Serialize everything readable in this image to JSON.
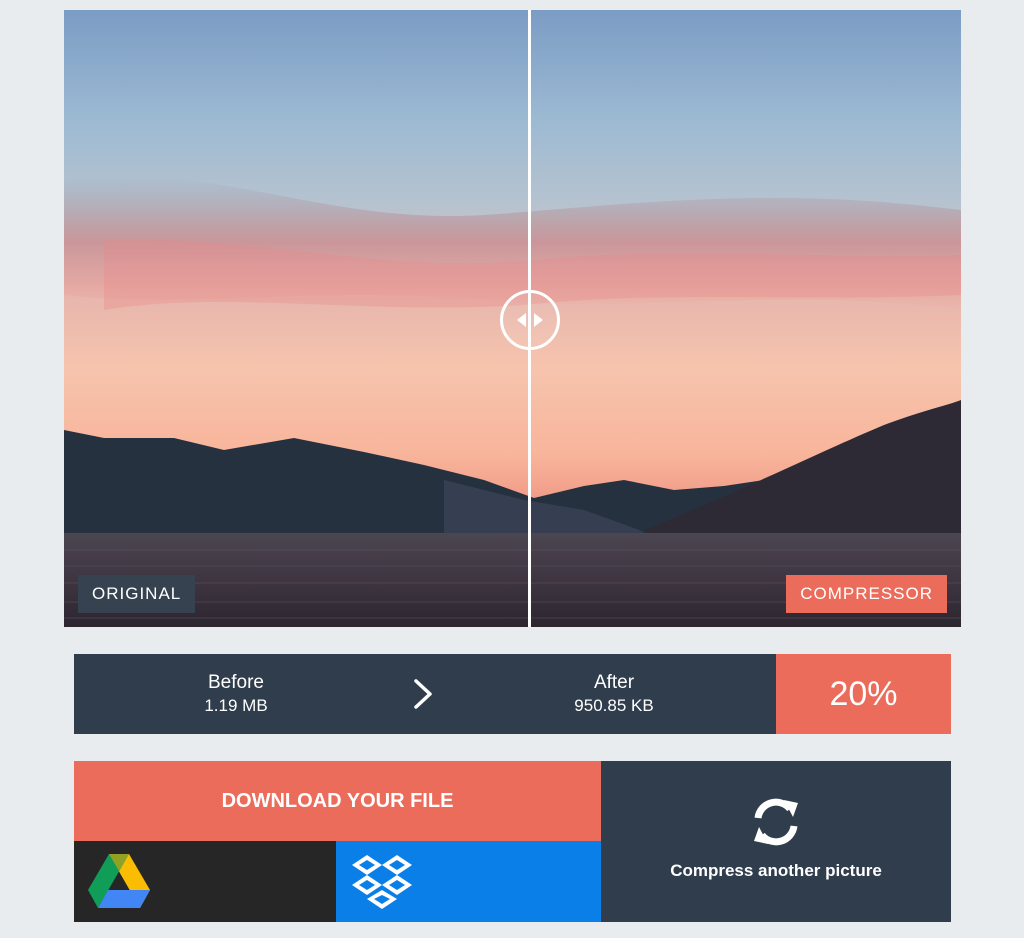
{
  "viewer": {
    "left_label": "ORIGINAL",
    "right_label": "COMPRESSOR"
  },
  "stats": {
    "before_label": "Before",
    "before_value": "1.19 MB",
    "after_label": "After",
    "after_value": "950.85 KB",
    "percent": "20%"
  },
  "actions": {
    "download_label": "DOWNLOAD YOUR FILE",
    "compress_again_label": "Compress another picture",
    "gdrive_icon": "google-drive-icon",
    "dropbox_icon": "dropbox-icon",
    "refresh_icon": "refresh-icon"
  },
  "colors": {
    "accent": "#ec6c5c",
    "panel": "#2f3d4c",
    "dropbox": "#0b7fe8"
  }
}
